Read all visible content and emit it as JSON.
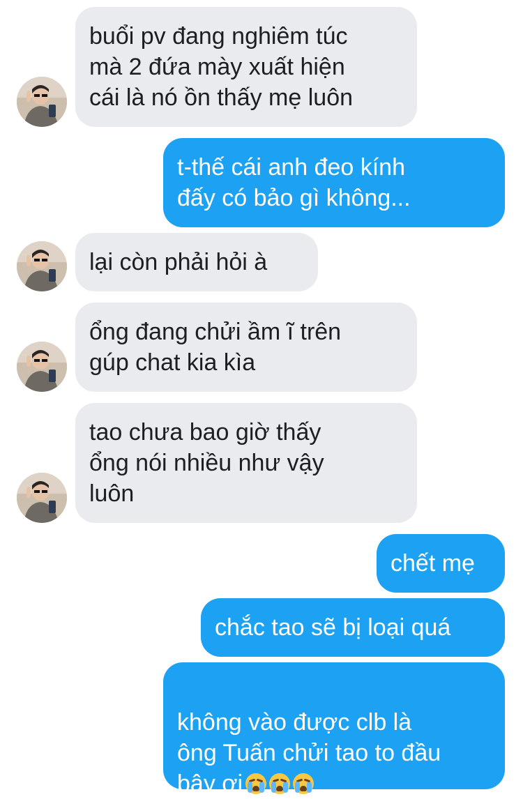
{
  "messages": [
    {
      "side": "in",
      "text": "buổi pv đang nghiêm túc\nmà 2 đứa mày xuất hiện\ncái là nó ồn thấy mẹ luôn"
    },
    {
      "side": "out",
      "text": "t-thế cái anh đeo kính\nđấy có bảo gì không..."
    },
    {
      "side": "in",
      "text": "lại còn phải hỏi à"
    },
    {
      "side": "in",
      "text": "ổng đang chửi ầm ĩ trên\ngúp chat kia kìa"
    },
    {
      "side": "in",
      "text": "tao chưa bao giờ thấy\nổng nói nhiều như vậy\nluôn"
    },
    {
      "side": "out",
      "text": "chết mẹ"
    },
    {
      "side": "out",
      "text": "chắc tao sẽ bị loại quá"
    },
    {
      "side": "out",
      "text": "không vào được clb là\nông Tuấn chửi tao to đầu\nbây ơi"
    }
  ],
  "emoji": [
    "loudly-crying-face",
    "loudly-crying-face",
    "loudly-crying-face"
  ],
  "colors": {
    "incoming_bubble": "#e9ebee",
    "outgoing_bubble": "#1da1f2",
    "incoming_text": "#1c1e21",
    "outgoing_text": "#ffffff"
  }
}
